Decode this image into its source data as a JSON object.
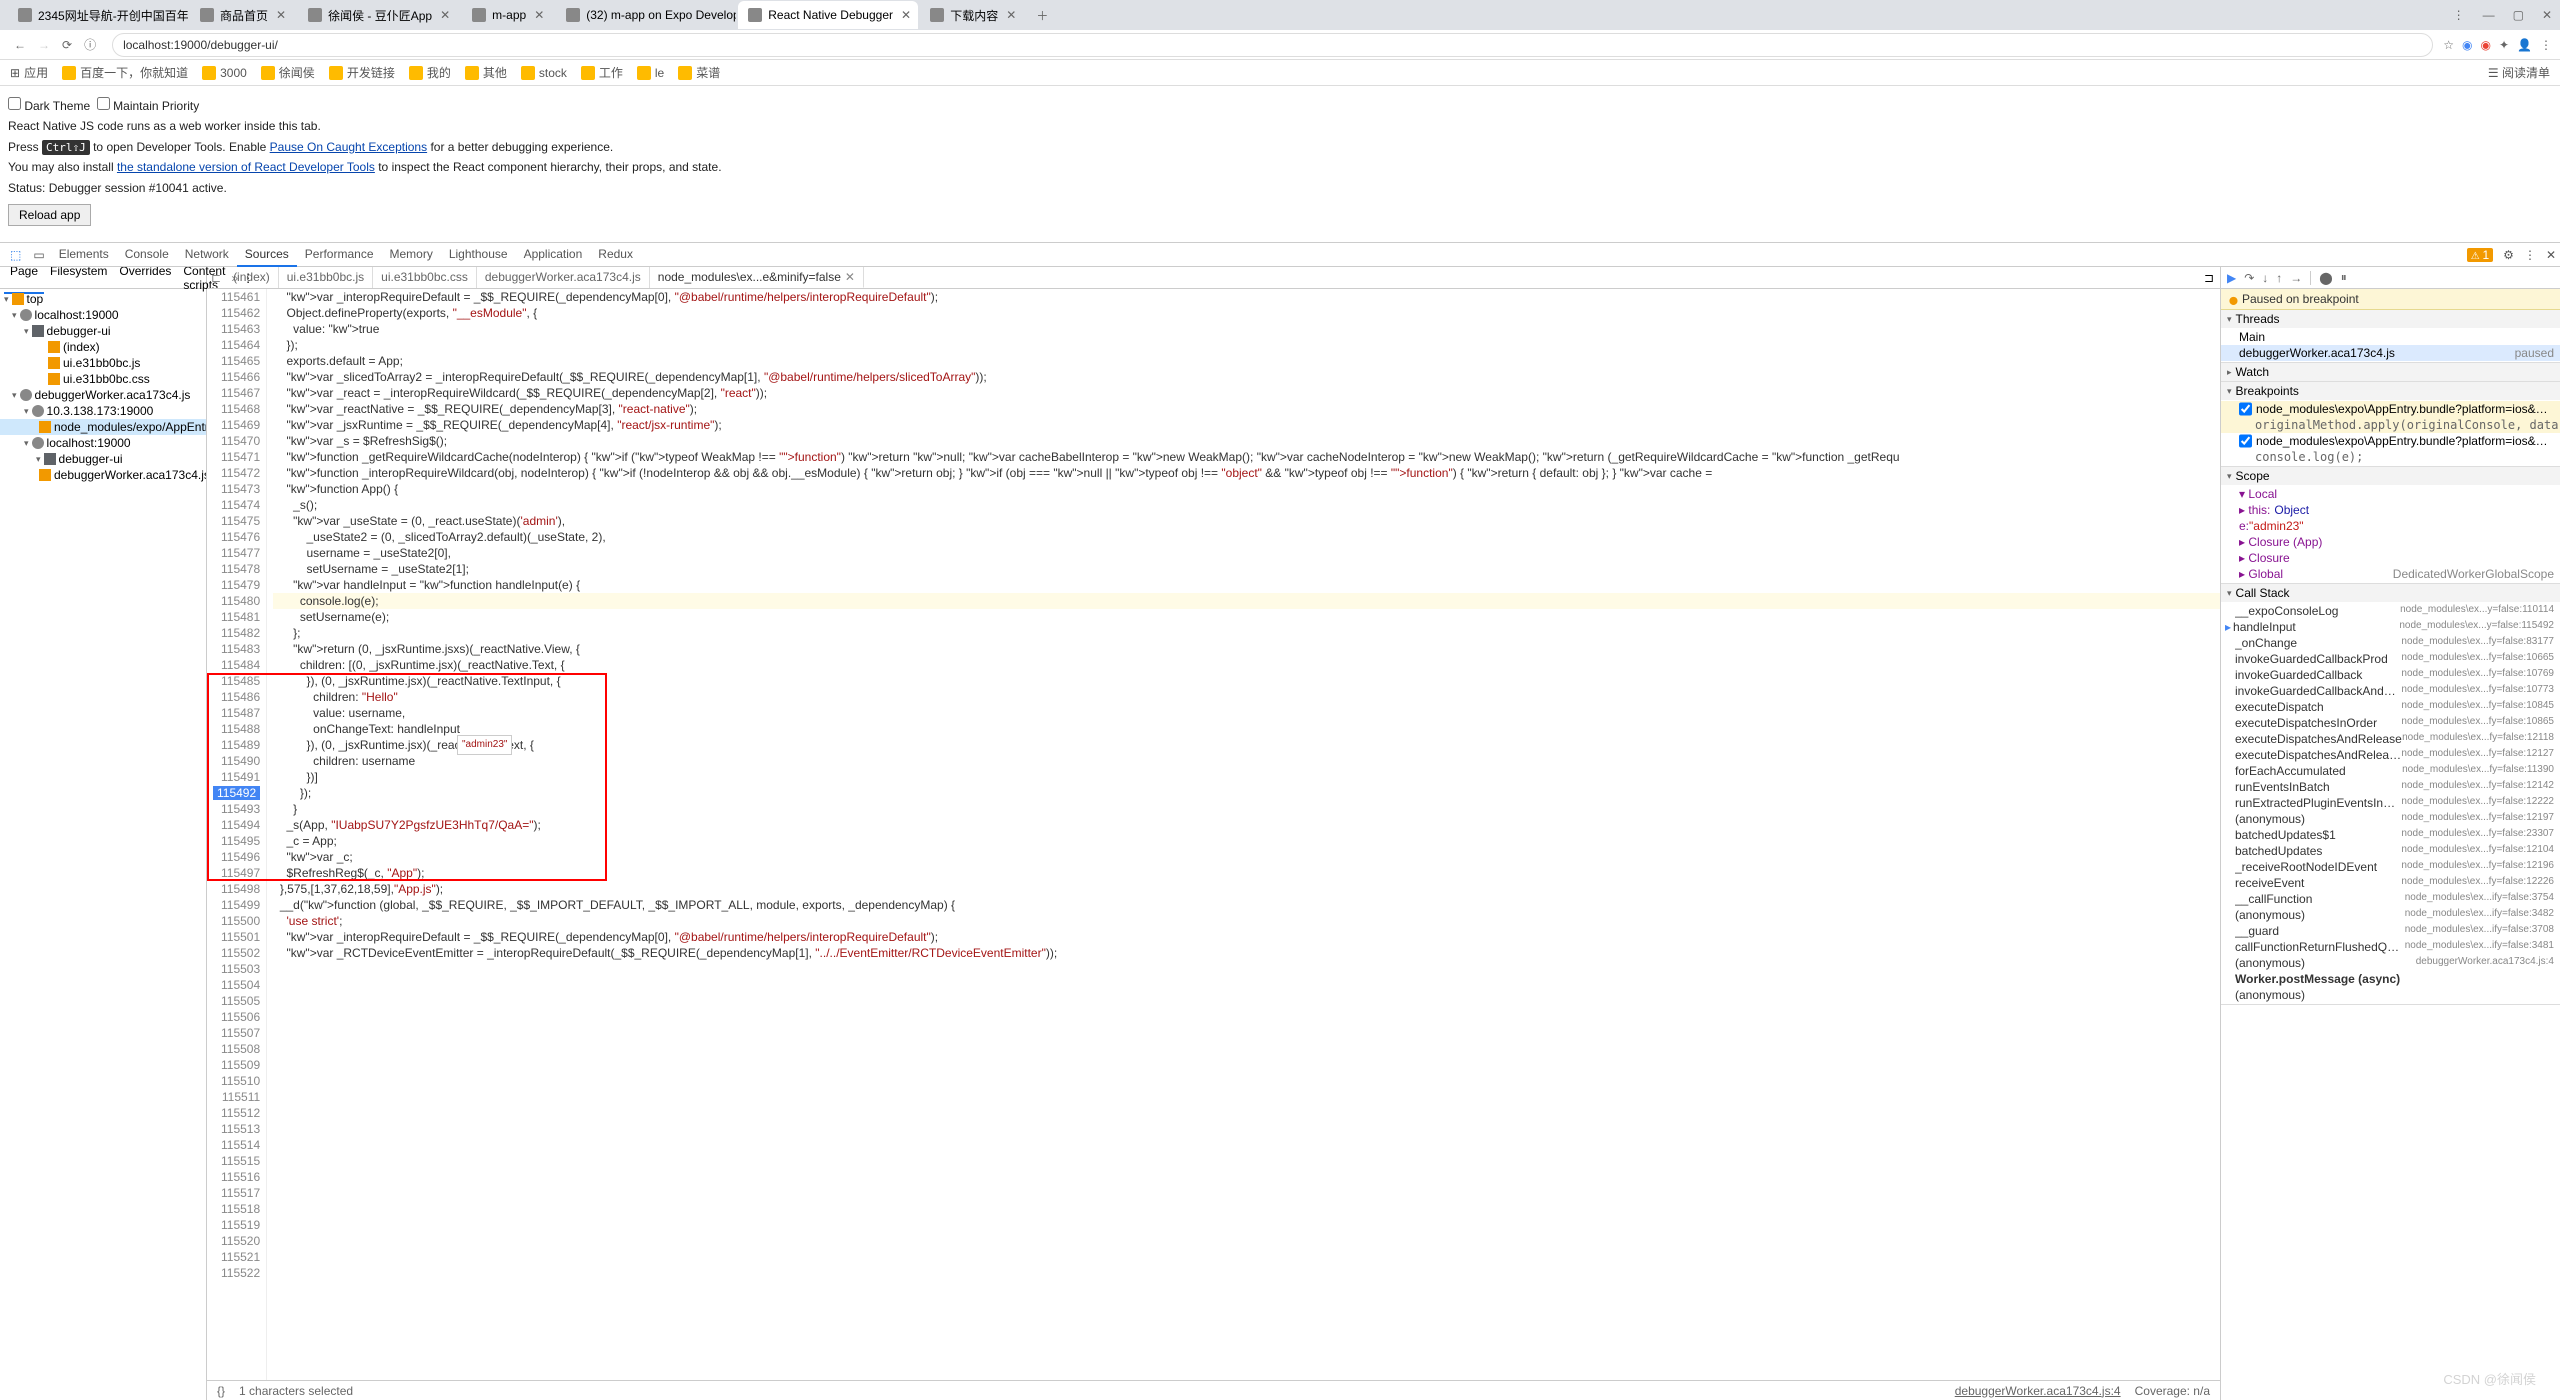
{
  "browser": {
    "tabs": [
      {
        "label": "2345网址导航-开创中国百年...",
        "active": false
      },
      {
        "label": "商品首页",
        "active": false
      },
      {
        "label": "徐闻侯 - 豆仆匠App",
        "active": false
      },
      {
        "label": "m-app",
        "active": false
      },
      {
        "label": "(32) m-app on Expo Develop...",
        "active": false
      },
      {
        "label": "React Native Debugger",
        "active": true
      },
      {
        "label": "下载内容",
        "active": false
      }
    ],
    "url": "localhost:19000/debugger-ui/",
    "bookmarks": [
      "应用",
      "百度一下，你就知道",
      "3000",
      "徐闻侯",
      "开发链接",
      "我的",
      "其他",
      "stock",
      "工作",
      "le",
      "菜谱"
    ],
    "reading_list": "阅读清单"
  },
  "page": {
    "dark_theme_label": "Dark Theme",
    "maintain_priority_label": "Maintain Priority",
    "desc": "React Native JS code runs as a web worker inside this tab.",
    "press": "Press ",
    "kbd": "Ctrl⇧J",
    "press2": " to open Developer Tools. Enable ",
    "link_pause": "Pause On Caught Exceptions",
    "press3": " for a better debugging experience.",
    "install1": "You may also install ",
    "link_install": "the standalone version of React Developer Tools",
    "install2": " to inspect the React component hierarchy, their props, and state.",
    "status": "Status: Debugger session #10041 active.",
    "reload": "Reload app"
  },
  "devtools": {
    "tabs": [
      "Elements",
      "Console",
      "Network",
      "Sources",
      "Performance",
      "Memory",
      "Lighthouse",
      "Application",
      "Redux"
    ],
    "active_tab": "Sources",
    "warn_count": "1",
    "left_tabs": [
      "Page",
      "Filesystem",
      "Overrides",
      "Content scripts"
    ],
    "file_tree": [
      {
        "d": 0,
        "t": "tri",
        "open": true,
        "label": "top"
      },
      {
        "d": 1,
        "t": "cloud",
        "open": true,
        "label": "localhost:19000"
      },
      {
        "d": 2,
        "t": "folder",
        "open": true,
        "label": "debugger-ui"
      },
      {
        "d": 3,
        "t": "file",
        "label": "(index)"
      },
      {
        "d": 3,
        "t": "file",
        "label": "ui.e31bb0bc.js"
      },
      {
        "d": 3,
        "t": "file",
        "label": "ui.e31bb0bc.css"
      },
      {
        "d": 1,
        "t": "cloud",
        "open": true,
        "label": "debuggerWorker.aca173c4.js"
      },
      {
        "d": 2,
        "t": "cloud",
        "open": true,
        "label": "10.3.138.173:19000"
      },
      {
        "d": 3,
        "t": "file",
        "sel": true,
        "label": "node_modules/expo/AppEntry.bundle?platform=ios&d..."
      },
      {
        "d": 2,
        "t": "cloud",
        "open": true,
        "label": "localhost:19000"
      },
      {
        "d": 3,
        "t": "folder",
        "open": true,
        "label": "debugger-ui"
      },
      {
        "d": 3,
        "t": "file",
        "label": "debuggerWorker.aca173c4.js"
      }
    ],
    "file_tabs": [
      {
        "label": "(index)"
      },
      {
        "label": "ui.e31bb0bc.js"
      },
      {
        "label": "ui.e31bb0bc.css"
      },
      {
        "label": "debuggerWorker.aca173c4.js"
      },
      {
        "label": "node_modules\\ex...e&minify=false",
        "active": true,
        "close": true
      }
    ],
    "tooltip_value": "\"admin23\"",
    "code_start": 115461,
    "code_lines": [
      "    var _interopRequireDefault = _$$_REQUIRE(_dependencyMap[0], \"@babel/runtime/helpers/interopRequireDefault\");",
      "",
      "",
      "    Object.defineProperty(exports, \"__esModule\", {",
      "      value: true",
      "    });",
      "    exports.default = App;",
      "",
      "    var _slicedToArray2 = _interopRequireDefault(_$$_REQUIRE(_dependencyMap[1], \"@babel/runtime/helpers/slicedToArray\"));",
      "",
      "    var _react = _interopRequireWildcard(_$$_REQUIRE(_dependencyMap[2], \"react\"));",
      "",
      "    var _reactNative = _$$_REQUIRE(_dependencyMap[3], \"react-native\");",
      "",
      "    var _jsxRuntime = _$$_REQUIRE(_dependencyMap[4], \"react/jsx-runtime\");",
      "",
      "    var _s = $RefreshSig$();",
      "",
      "    function _getRequireWildcardCache(nodeInterop) { if (typeof WeakMap !== \"function\") return null; var cacheBabelInterop = new WeakMap(); var cacheNodeInterop = new WeakMap(); return (_getRequireWildcardCache = function _getRequ",
      "",
      "    function _interopRequireWildcard(obj, nodeInterop) { if (!nodeInterop && obj && obj.__esModule) { return obj; } if (obj === null || typeof obj !== \"object\" && typeof obj !== \"function\") { return { default: obj }; } var cache =",
      "",
      "    function App() {",
      "      _s();",
      "",
      "      var _useState = (0, _react.useState)('admin'),",
      "          _useState2 = (0, _slicedToArray2.default)(_useState, 2),",
      "          username = _useState2[0],",
      "          setUsername = _useState2[1];",
      "",
      "      var handleInput = function handleInput(e) {",
      "        console.log(e);",
      "        setUsername(e);",
      "      };",
      "",
      "      return (0, _jsxRuntime.jsxs)(_reactNative.View, {",
      "        children: [(0, _jsxRuntime.jsx)(_reactNative.Text, {",
      "          }), (0, _jsxRuntime.jsx)(_reactNative.TextInput, {",
      "            children: \"Hello\"",
      "            value: username,",
      "            onChangeText: handleInput",
      "          }), (0, _jsxRuntime.jsx)(_reactNative.Text, {",
      "            children: username",
      "          })]",
      "        });",
      "      }",
      "",
      "    _s(App, \"IUabpSU7Y2PgsfzUE3HhTq7/QaA=\");",
      "",
      "    _c = App;",
      "",
      "    var _c;",
      "",
      "    $RefreshReg$(_c, \"App\");",
      "  },575,[1,37,62,18,59],\"App.js\");",
      "  __d(function (global, _$$_REQUIRE, _$$_IMPORT_DEFAULT, _$$_IMPORT_ALL, module, exports, _dependencyMap) {",
      "    'use strict';",
      "",
      "    var _interopRequireDefault = _$$_REQUIRE(_dependencyMap[0], \"@babel/runtime/helpers/interopRequireDefault\");",
      "",
      "    var _RCTDeviceEventEmitter = _interopRequireDefault(_$$_REQUIRE(_dependencyMap[1], \"../../EventEmitter/RCTDeviceEventEmitter\"));",
      ""
    ],
    "bp_line": 115492,
    "red_box": {
      "start": 115485,
      "end": 115497
    },
    "status": {
      "sel": "1 characters selected",
      "file": "debuggerWorker.aca173c4.js:4",
      "cov": "Coverage: n/a"
    }
  },
  "debugger": {
    "paused": "Paused on breakpoint",
    "threads": {
      "label": "Threads",
      "items": [
        {
          "name": "Main"
        },
        {
          "name": "debuggerWorker.aca173c4.js",
          "status": "paused",
          "sel": true
        }
      ]
    },
    "watch": "Watch",
    "breakpoints": {
      "label": "Breakpoints",
      "items": [
        {
          "file": "node_modules\\expo\\AppEntry.bundle?platform=ios&dev=true&hot=false&strict=false&minify=false:1...",
          "code": "originalMethod.apply(originalConsole, data);",
          "hl": true
        },
        {
          "file": "node_modules\\expo\\AppEntry.bundle?platform=ios&dev=true&hot=false&strict=false&minify=false:11...",
          "code": "console.log(e);"
        }
      ]
    },
    "scope": {
      "label": "Scope",
      "items": [
        {
          "k": "▾ Local"
        },
        {
          "k": "  ▸ this:",
          "v": "Object"
        },
        {
          "k": "    e:",
          "s": "\"admin23\""
        },
        {
          "k": "▸ Closure (App)"
        },
        {
          "k": "▸ Closure"
        },
        {
          "k": "▸ Global",
          "r": "DedicatedWorkerGlobalScope"
        }
      ]
    },
    "callstack": {
      "label": "Call Stack",
      "items": [
        {
          "fn": "__expoConsoleLog",
          "loc": "node_modules\\ex...y=false:110114"
        },
        {
          "fn": "handleInput",
          "loc": "node_modules\\ex...y=false:115492",
          "sel": true
        },
        {
          "fn": "_onChange",
          "loc": "node_modules\\ex...fy=false:83177"
        },
        {
          "fn": "invokeGuardedCallbackProd",
          "loc": "node_modules\\ex...fy=false:10665"
        },
        {
          "fn": "invokeGuardedCallback",
          "loc": "node_modules\\ex...fy=false:10769"
        },
        {
          "fn": "invokeGuardedCallbackAndCatchFirstError",
          "loc": "node_modules\\ex...fy=false:10773"
        },
        {
          "fn": "executeDispatch",
          "loc": "node_modules\\ex...fy=false:10845"
        },
        {
          "fn": "executeDispatchesInOrder",
          "loc": "node_modules\\ex...fy=false:10865"
        },
        {
          "fn": "executeDispatchesAndRelease",
          "loc": "node_modules\\ex...fy=false:12118"
        },
        {
          "fn": "executeDispatchesAndReleaseTopLevel",
          "loc": "node_modules\\ex...fy=false:12127"
        },
        {
          "fn": "forEachAccumulated",
          "loc": "node_modules\\ex...fy=false:11390"
        },
        {
          "fn": "runEventsInBatch",
          "loc": "node_modules\\ex...fy=false:12142"
        },
        {
          "fn": "runExtractedPluginEventsInBatch",
          "loc": "node_modules\\ex...fy=false:12222"
        },
        {
          "fn": "(anonymous)",
          "loc": "node_modules\\ex...fy=false:12197"
        },
        {
          "fn": "batchedUpdates$1",
          "loc": "node_modules\\ex...fy=false:23307"
        },
        {
          "fn": "batchedUpdates",
          "loc": "node_modules\\ex...fy=false:12104"
        },
        {
          "fn": "_receiveRootNodeIDEvent",
          "loc": "node_modules\\ex...fy=false:12196"
        },
        {
          "fn": "receiveEvent",
          "loc": "node_modules\\ex...fy=false:12226"
        },
        {
          "fn": "__callFunction",
          "loc": "node_modules\\ex...ify=false:3754"
        },
        {
          "fn": "(anonymous)",
          "loc": "node_modules\\ex...ify=false:3482"
        },
        {
          "fn": "__guard",
          "loc": "node_modules\\ex...ify=false:3708"
        },
        {
          "fn": "callFunctionReturnFlushedQueue",
          "loc": "node_modules\\ex...ify=false:3481"
        },
        {
          "fn": "(anonymous)",
          "loc": "debuggerWorker.aca173c4.js:4"
        },
        {
          "fn": "Worker.postMessage (async)",
          "loc": "",
          "hdr": true
        },
        {
          "fn": "(anonymous)",
          "loc": ""
        }
      ]
    }
  },
  "watermark": "CSDN @徐闻侯"
}
